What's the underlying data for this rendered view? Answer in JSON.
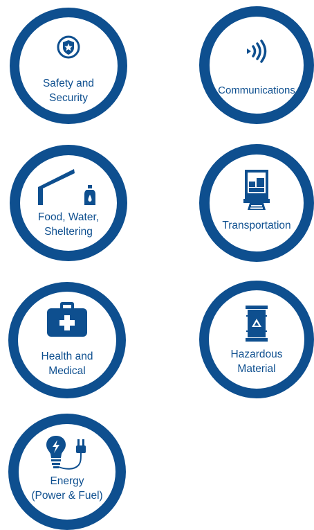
{
  "colors": {
    "ring": "#0e4f8f",
    "icon": "#0e4f8f",
    "text": "#0e4f8f",
    "background": "#ffffff"
  },
  "lifelines": [
    {
      "label": "Safety and\nSecurity",
      "icon": "police-badge-icon"
    },
    {
      "label": "Communications",
      "icon": "signal-waves-icon"
    },
    {
      "label": "Food, Water,\nSheltering",
      "icon": "shelter-bottle-icon"
    },
    {
      "label": "Transportation",
      "icon": "truck-icon"
    },
    {
      "label": "Health and\nMedical",
      "icon": "medical-kit-icon"
    },
    {
      "label": "Hazardous\nMaterial",
      "icon": "hazmat-barrel-icon"
    },
    {
      "label": "Energy\n(Power & Fuel)",
      "icon": "lightbulb-plug-icon"
    }
  ]
}
